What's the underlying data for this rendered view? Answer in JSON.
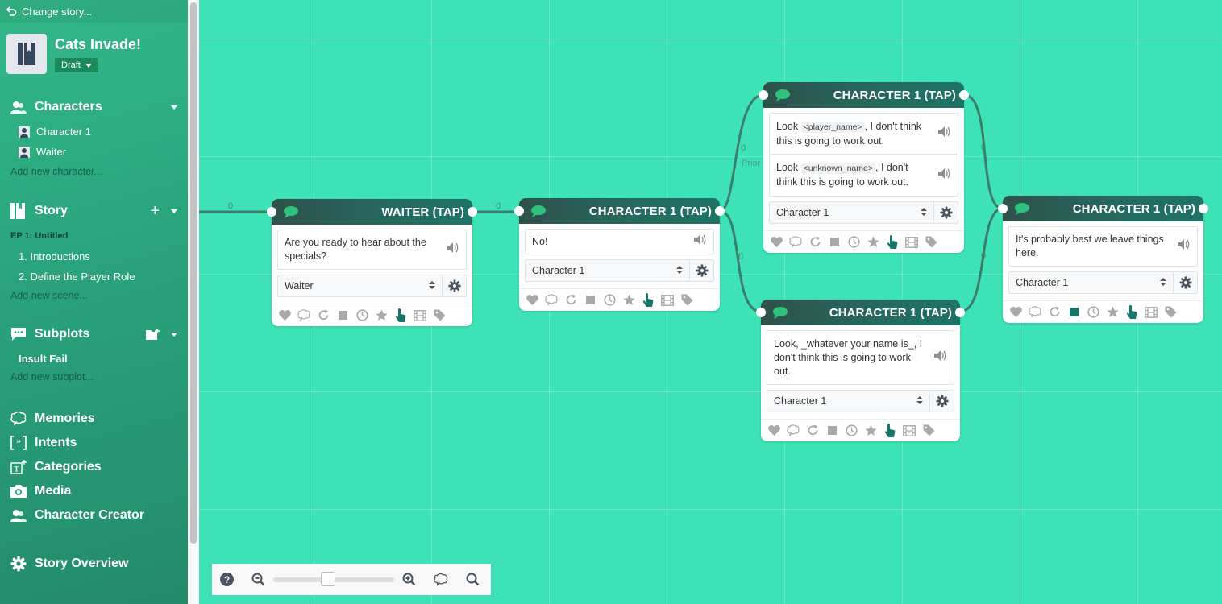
{
  "sidebar": {
    "change_story": "Change story...",
    "story_title": "Cats Invade!",
    "status": "Draft",
    "characters": {
      "label": "Characters",
      "items": [
        "Character 1",
        "Waiter"
      ],
      "add": "Add new character..."
    },
    "story": {
      "label": "Story",
      "episode": "EP 1: Untitled",
      "scenes": [
        "1. Introductions",
        "2. Define the Player Role"
      ],
      "add": "Add new scene..."
    },
    "subplots": {
      "label": "Subplots",
      "items": [
        "Insult Fail"
      ],
      "add": "Add new subplot..."
    },
    "nav": {
      "memories": "Memories",
      "intents": "Intents",
      "categories": "Categories",
      "media": "Media",
      "character_creator": "Character Creator",
      "story_overview": "Story Overview"
    }
  },
  "canvas": {
    "wire_labels": [
      "0",
      "0",
      "0",
      "Prior",
      "0",
      "0",
      "0"
    ],
    "nodes": [
      {
        "title": "WAITER (TAP)",
        "lines": [
          {
            "text": "Are you ready to hear about the specials?"
          }
        ],
        "character": "Waiter",
        "active_icons": [
          "tap"
        ]
      },
      {
        "title": "CHARACTER 1 (TAP)",
        "lines": [
          {
            "text": "No!"
          }
        ],
        "character": "Character 1",
        "active_icons": [
          "tap"
        ]
      },
      {
        "title": "CHARACTER 1 (TAP)",
        "lines": [
          {
            "pre": "Look",
            "tag": "<player_name>",
            "post": ", I don't think this is going to work out."
          },
          {
            "pre": "Look",
            "tag": "<unknown_name>",
            "post": ", I don't think this is going to work out."
          }
        ],
        "character": "Character 1",
        "active_icons": [
          "tap"
        ]
      },
      {
        "title": "CHARACTER 1 (TAP)",
        "lines": [
          {
            "text": "Look, _whatever your name is_, I don't think this is going to work out."
          }
        ],
        "character": "Character 1",
        "active_icons": [
          "tap"
        ]
      },
      {
        "title": "CHARACTER 1 (TAP)",
        "lines": [
          {
            "text": "It's probably best we leave things here."
          }
        ],
        "character": "Character 1",
        "active_icons": [
          "tap",
          "stop"
        ]
      }
    ],
    "node_icons": [
      "heart",
      "brain",
      "repeat",
      "stop",
      "clock",
      "star",
      "tap",
      "film",
      "tag"
    ]
  },
  "zoom_toolbar": {
    "zoom_level": 0.45
  },
  "colors": {
    "canvas_bg": "#3de3b6",
    "sidebar_top": "#33b889",
    "node_header": "#256a5f",
    "active_icon": "#17756a",
    "inactive_icon": "#a9a9a9",
    "speech_bubble": "#2ec27e"
  }
}
